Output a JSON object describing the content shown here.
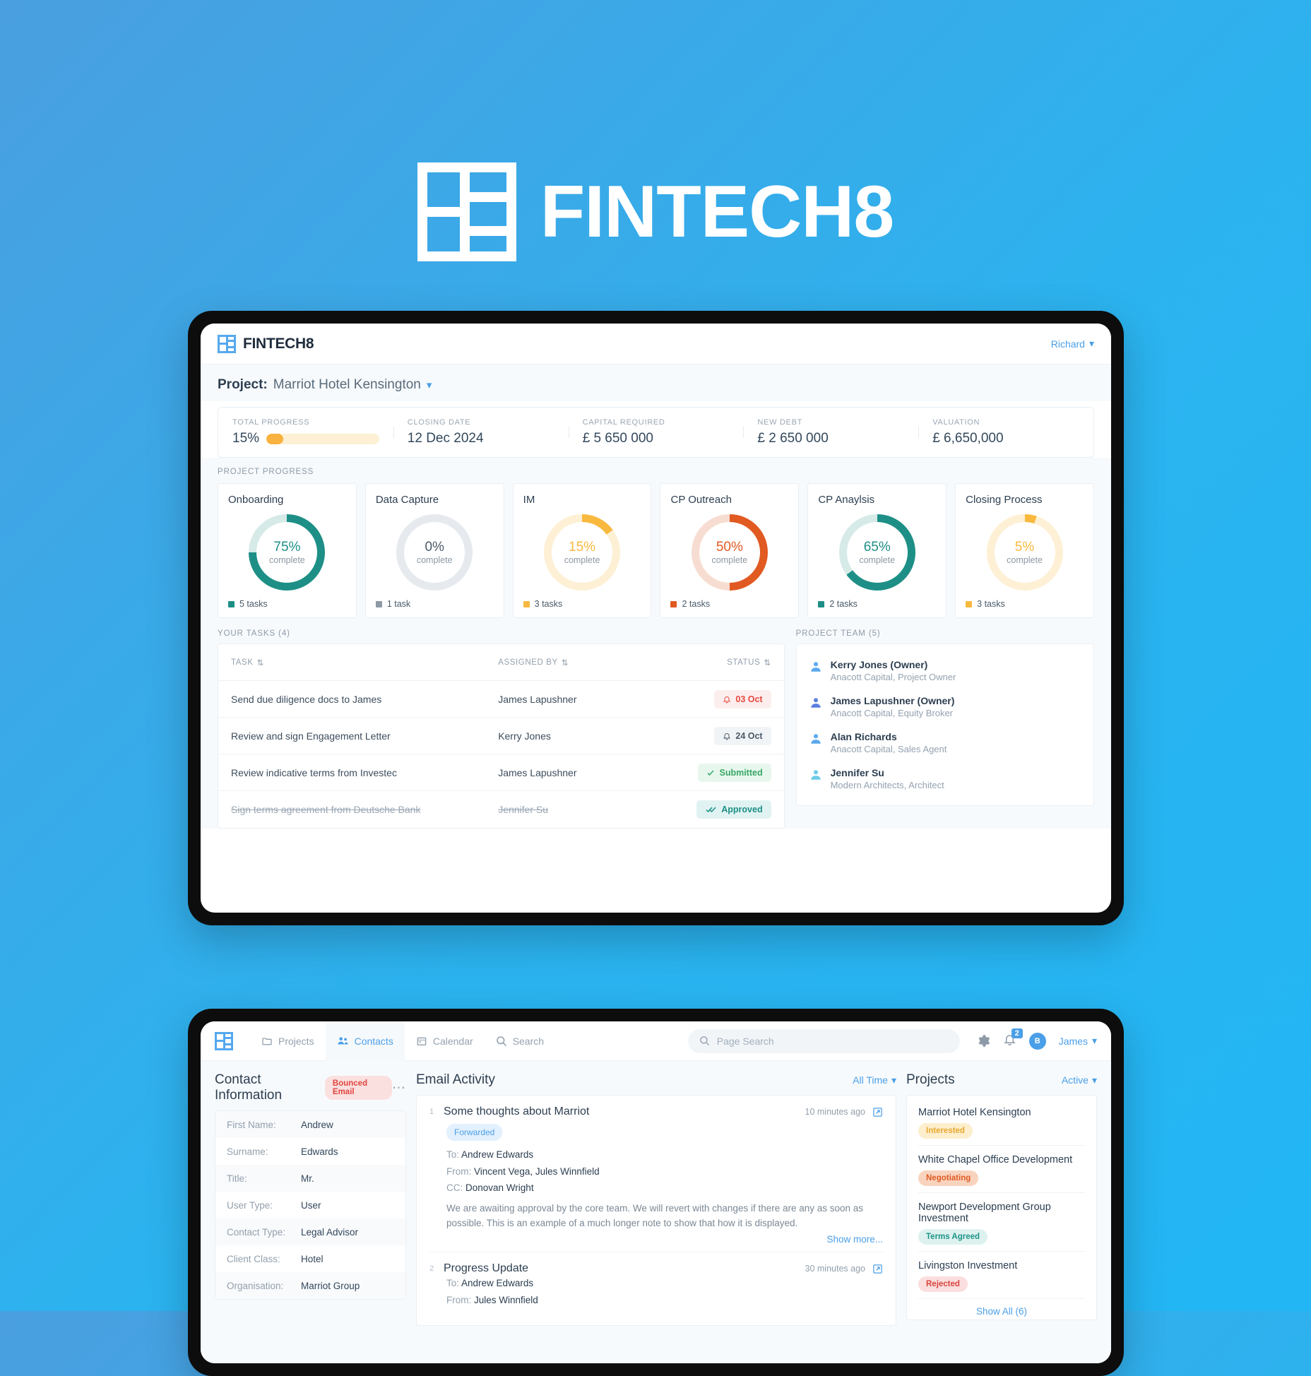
{
  "hero": {
    "brand_name": "FINTECH8"
  },
  "top_app": {
    "brand_name": "FINTECH8",
    "user_menu": "Richard",
    "project_label": "Project:",
    "project_name": "Marriot Hotel Kensington",
    "stats": [
      {
        "label": "TOTAL PROGRESS",
        "value": "15%",
        "progress": 15
      },
      {
        "label": "CLOSING DATE",
        "value": "12 Dec 2024"
      },
      {
        "label": "CAPITAL REQUIRED",
        "value": "£ 5 650 000"
      },
      {
        "label": "NEW DEBT",
        "value": "£ 2 650 000"
      },
      {
        "label": "VALUATION",
        "value": "£ 6,650,000"
      }
    ],
    "progress_section_title": "PROJECT PROGRESS",
    "tasks_title": "YOUR TASKS (4)",
    "team_title": "PROJECT TEAM (5)",
    "table_headers": {
      "task": "TASK",
      "assigned_by": "ASSIGNED BY",
      "status": "STATUS"
    },
    "tasks": [
      {
        "task": "Send due diligence docs to James",
        "by": "James Lapushner",
        "status": "03 Oct",
        "status_kind": "red",
        "icon": "bell-icon",
        "done": false
      },
      {
        "task": "Review and sign Engagement Letter",
        "by": "Kerry Jones",
        "status": "24 Oct",
        "status_kind": "grey",
        "icon": "bell-icon",
        "done": false
      },
      {
        "task": "Review indicative terms from Investec",
        "by": "James Lapushner",
        "status": "Submitted",
        "status_kind": "green",
        "icon": "check-icon",
        "done": false
      },
      {
        "task": "Sign terms agreement from Deutsche Bank",
        "by": "Jennifer Su",
        "status": "Approved",
        "status_kind": "teal",
        "icon": "double-check-icon",
        "done": true
      }
    ],
    "team": [
      {
        "name": "Kerry Jones (Owner)",
        "org": "Anacott Capital, Project Owner",
        "color": "#5aa9ee"
      },
      {
        "name": "James Lapushner (Owner)",
        "org": "Anacott Capital, Equity Broker",
        "color": "#5a7fe0"
      },
      {
        "name": "Alan Richards",
        "org": "Anacott Capital, Sales Agent",
        "color": "#5aa9ee"
      },
      {
        "name": "Jennifer Su",
        "org": "Modern Architects, Architect",
        "color": "#6ecbe8"
      }
    ]
  },
  "chart_data": [
    {
      "type": "pie",
      "title": "Onboarding",
      "categories": [
        "complete",
        "remaining"
      ],
      "values": [
        75,
        25
      ],
      "percent": 75,
      "label": "75%",
      "sublabel": "complete",
      "tasks_label": "5 tasks",
      "color": "#1d8f86",
      "track_color": "#d6eae8"
    },
    {
      "type": "pie",
      "title": "Data Capture",
      "categories": [
        "complete",
        "remaining"
      ],
      "values": [
        0,
        100
      ],
      "percent": 0,
      "label": "0%",
      "sublabel": "complete",
      "tasks_label": "1 task",
      "color": "#8d99a6",
      "track_color": "#e6eaee"
    },
    {
      "type": "pie",
      "title": "IM",
      "categories": [
        "complete",
        "remaining"
      ],
      "values": [
        15,
        85
      ],
      "percent": 15,
      "label": "15%",
      "sublabel": "complete",
      "tasks_label": "3 tasks",
      "color": "#f9b93f",
      "track_color": "#fdf0d5"
    },
    {
      "type": "pie",
      "title": "CP Outreach",
      "categories": [
        "complete",
        "remaining"
      ],
      "values": [
        50,
        50
      ],
      "percent": 50,
      "label": "50%",
      "sublabel": "complete",
      "tasks_label": "2 tasks",
      "color": "#e05a22",
      "track_color": "#f7ddd1"
    },
    {
      "type": "pie",
      "title": "CP Anaylsis",
      "categories": [
        "complete",
        "remaining"
      ],
      "values": [
        65,
        35
      ],
      "percent": 65,
      "label": "65%",
      "sublabel": "complete",
      "tasks_label": "2 tasks",
      "color": "#1d8f86",
      "track_color": "#d6eae8"
    },
    {
      "type": "pie",
      "title": "Closing Process",
      "categories": [
        "complete",
        "remaining"
      ],
      "values": [
        5,
        95
      ],
      "percent": 5,
      "label": "5%",
      "sublabel": "complete",
      "tasks_label": "3 tasks",
      "color": "#f9b93f",
      "track_color": "#fdf0d5"
    }
  ],
  "bottom_app": {
    "nav": [
      {
        "label": "Projects",
        "icon": "folder-icon",
        "active": false
      },
      {
        "label": "Contacts",
        "icon": "people-icon",
        "active": true
      },
      {
        "label": "Calendar",
        "icon": "calendar-icon",
        "active": false
      },
      {
        "label": "Search",
        "icon": "search-icon",
        "active": false
      }
    ],
    "search_placeholder": "Page Search",
    "notifications_count": "2",
    "avatar_initials": "B",
    "user_menu": "James",
    "contact": {
      "title": "Contact Information",
      "badge": "Bounced Email",
      "rows": [
        {
          "key": "First Name:",
          "value": "Andrew"
        },
        {
          "key": "Surname:",
          "value": "Edwards"
        },
        {
          "key": "Title:",
          "value": "Mr."
        },
        {
          "key": "User Type:",
          "value": "User"
        },
        {
          "key": "Contact Type:",
          "value": "Legal Advisor"
        },
        {
          "key": "Client Class:",
          "value": "Hotel"
        },
        {
          "key": "Organisation:",
          "value": "Marriot Group"
        }
      ]
    },
    "email": {
      "title": "Email Activity",
      "filter": "All Time",
      "items": [
        {
          "num": "1",
          "subject": "Some thoughts about Marriot",
          "time": "10 minutes ago",
          "tag": "Forwarded",
          "to_key": "To:",
          "to": "Andrew Edwards",
          "from_key": "From:",
          "from": "Vincent Vega, Jules Winnfield",
          "cc_key": "CC:",
          "cc": "Donovan Wright",
          "body": "We are awaiting approval by the core team. We will revert with changes if there are any as soon as possible. This is an example of a much longer note to show that how it is displayed.",
          "show_more": "Show more..."
        },
        {
          "num": "2",
          "subject": "Progress Update",
          "time": "30 minutes ago",
          "to_key": "To:",
          "to": "Andrew Edwards",
          "from_key": "From:",
          "from": "Jules Winnfield"
        }
      ]
    },
    "projects": {
      "title": "Projects",
      "filter": "Active",
      "items": [
        {
          "name": "Marriot Hotel Kensington",
          "status": "Interested",
          "kind": "interested"
        },
        {
          "name": "White Chapel Office Development",
          "status": "Negotiating",
          "kind": "negotiating"
        },
        {
          "name": "Newport Development Group Investment",
          "status": "Terms Agreed",
          "kind": "terms"
        },
        {
          "name": "Livingston Investment",
          "status": "Rejected",
          "kind": "rejected"
        }
      ],
      "show_all": "Show All (6)"
    }
  }
}
